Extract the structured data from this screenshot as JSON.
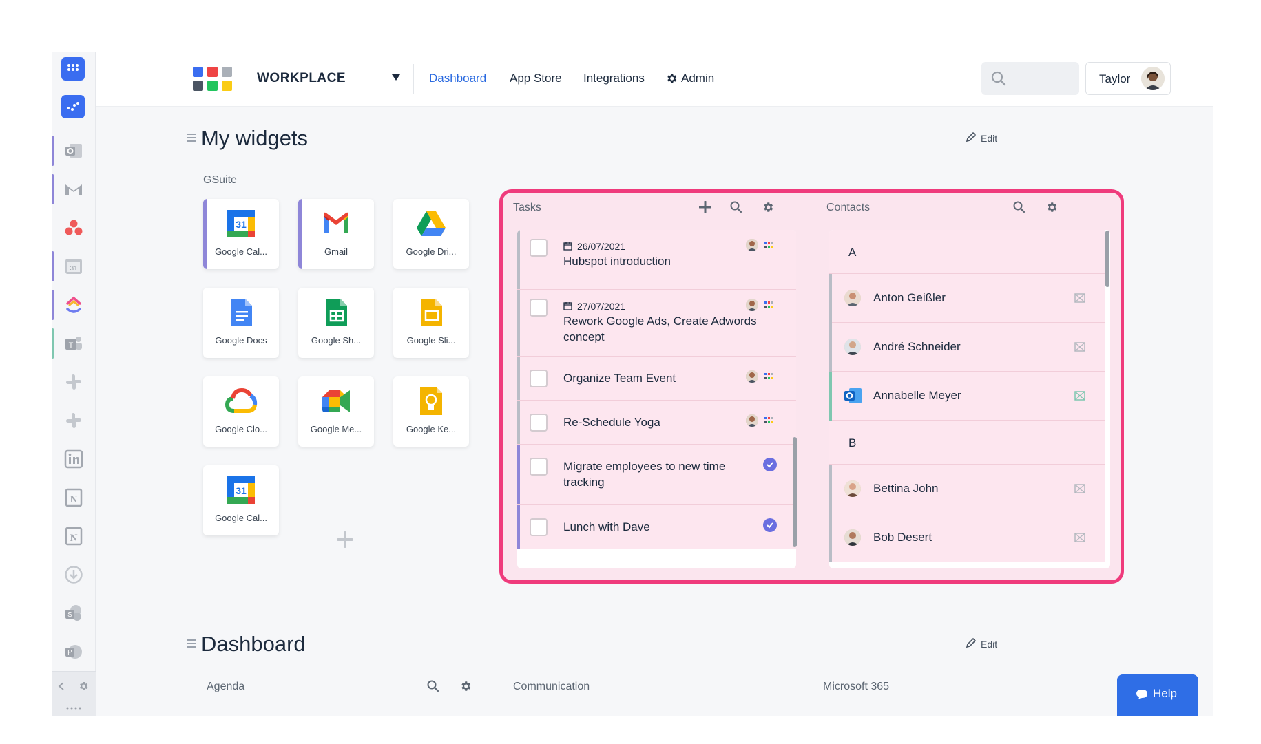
{
  "header": {
    "brand": "WORKPLACE",
    "nav": [
      {
        "label": "Dashboard",
        "active": true
      },
      {
        "label": "App Store",
        "active": false
      },
      {
        "label": "Integrations",
        "active": false
      },
      {
        "label": "Admin",
        "active": false
      }
    ],
    "user_name": "Taylor"
  },
  "my_widgets": {
    "title": "My widgets",
    "edit_label": "Edit",
    "gsuite_label": "GSuite",
    "tiles": [
      {
        "name": "Google Cal...",
        "icon": "google-calendar-icon"
      },
      {
        "name": "Gmail",
        "icon": "gmail-icon"
      },
      {
        "name": "Google Dri...",
        "icon": "google-drive-icon"
      },
      {
        "name": "Google Docs",
        "icon": "google-docs-icon"
      },
      {
        "name": "Google Sh...",
        "icon": "google-sheets-icon"
      },
      {
        "name": "Google Sli...",
        "icon": "google-slides-icon"
      },
      {
        "name": "Google Clo...",
        "icon": "google-cloud-icon"
      },
      {
        "name": "Google Me...",
        "icon": "google-meet-icon"
      },
      {
        "name": "Google Ke...",
        "icon": "google-keep-icon"
      },
      {
        "name": "Google Cal...",
        "icon": "google-calendar-icon"
      }
    ]
  },
  "tasks": {
    "title": "Tasks",
    "items": [
      {
        "date": "26/07/2021",
        "title": "Hubspot introduction"
      },
      {
        "date": "27/07/2021",
        "title": "Rework Google Ads, Create Adwords concept"
      },
      {
        "date": "",
        "title": "Organize Team Event"
      },
      {
        "date": "",
        "title": "Re-Schedule Yoga"
      },
      {
        "date": "",
        "title": "Migrate employees to new time tracking"
      },
      {
        "date": "",
        "title": "Lunch with Dave"
      }
    ]
  },
  "contacts": {
    "title": "Contacts",
    "groups": [
      {
        "letter": "A",
        "names": [
          "Anton Geißler",
          "André Schneider",
          "Annabelle Meyer"
        ]
      },
      {
        "letter": "B",
        "names": [
          "Bettina John",
          "Bob Desert"
        ]
      }
    ]
  },
  "dashboard": {
    "title": "Dashboard",
    "edit_label": "Edit",
    "columns": [
      "Agenda",
      "Communication",
      "Microsoft 365"
    ]
  },
  "help_label": "Help",
  "colors": {
    "accent": "#2f6ee6",
    "highlight": "#ef3b7c",
    "highlight_bg": "#fbe5ee"
  }
}
